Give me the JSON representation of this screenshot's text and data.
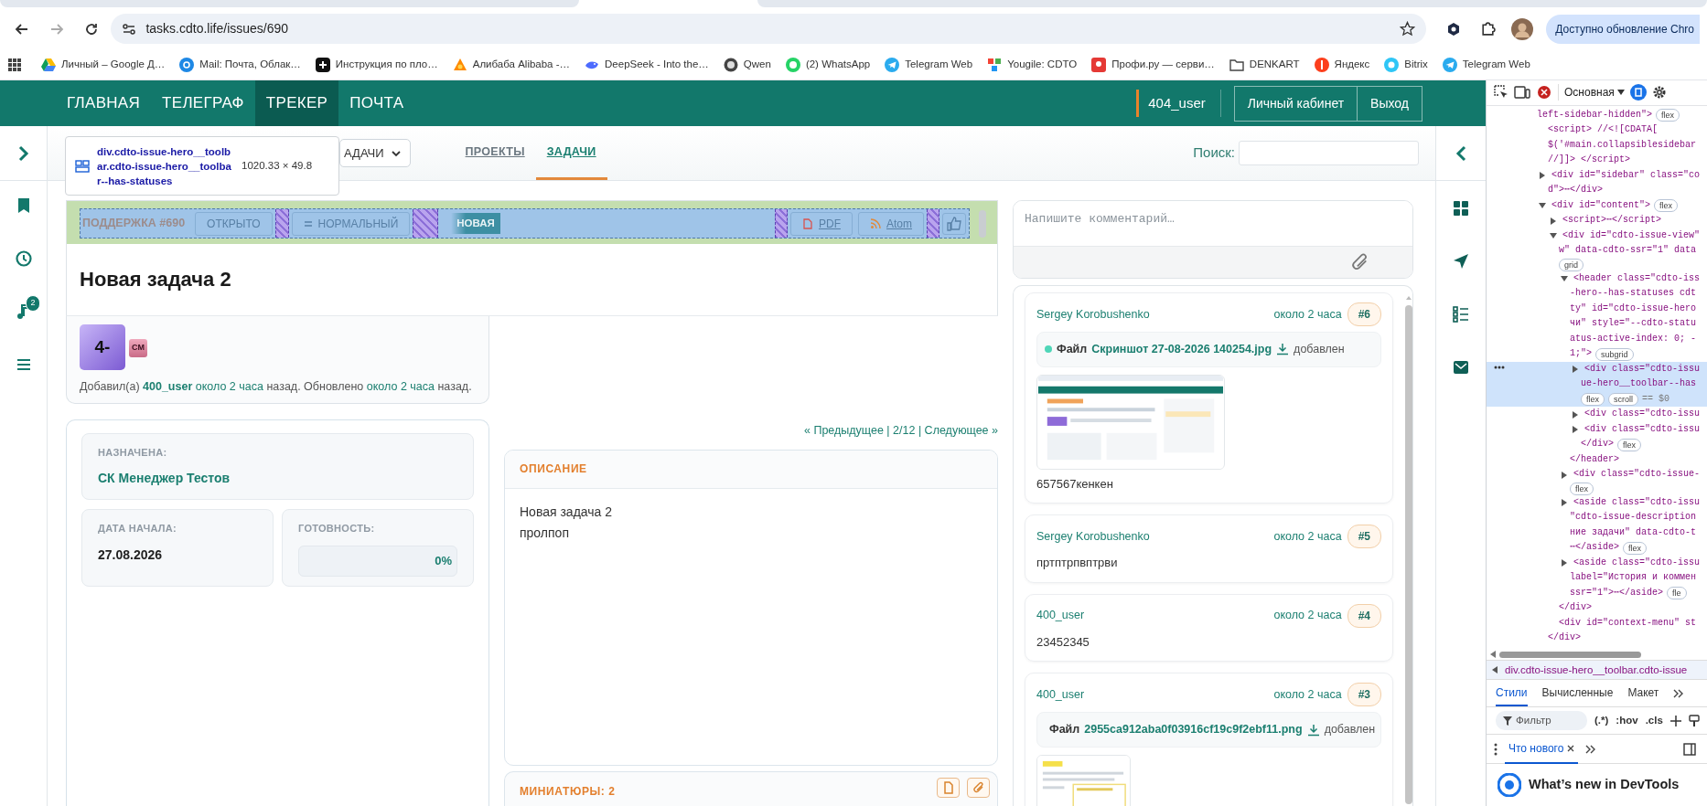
{
  "browser": {
    "address": "tasks.cdto.life/issues/690",
    "update_button": "Доступно обновление Chro",
    "bookmarks": [
      {
        "label": "Личный – Google Д…",
        "kind": "drive"
      },
      {
        "label": "Mail: Почта, Облак…",
        "kind": "mail"
      },
      {
        "label": "Инструкция по пло…",
        "kind": "plus"
      },
      {
        "label": "Алибаба Alibaba -…",
        "kind": "alibaba"
      },
      {
        "label": "DeepSeek - Into the…",
        "kind": "whale"
      },
      {
        "label": "Qwen",
        "kind": "qwen"
      },
      {
        "label": "(2) WhatsApp",
        "kind": "whatsapp"
      },
      {
        "label": "Telegram Web",
        "kind": "telegram"
      },
      {
        "label": "Yougile: CDTO",
        "kind": "yougile"
      },
      {
        "label": "Профи.ру — серви…",
        "kind": "profi"
      },
      {
        "label": "DENKART",
        "kind": "folder"
      },
      {
        "label": "Яндекс",
        "kind": "yandex"
      },
      {
        "label": "Bitrix",
        "kind": "bitrix"
      },
      {
        "label": "Telegram Web",
        "kind": "telegram"
      }
    ]
  },
  "navbar": {
    "items": [
      {
        "label": "ГЛАВНАЯ",
        "selected": false
      },
      {
        "label": "ТЕЛЕГРАФ",
        "selected": false
      },
      {
        "label": "ТРЕКЕР",
        "selected": true
      },
      {
        "label": "ПОЧТА",
        "selected": false
      }
    ],
    "user": "404_user",
    "buttons": [
      "Личный кабинет",
      "Выход"
    ]
  },
  "sidebar": {
    "badge": "2"
  },
  "subnav": {
    "dropdown": "АДАЧИ",
    "tabs": [
      {
        "label": "ПРОЕКТЫ",
        "selected": false
      },
      {
        "label": "ЗАДАЧИ",
        "selected": true
      }
    ],
    "search_label": "Поиск:"
  },
  "inspect_tooltip": {
    "selector": "div.cdto-issue-hero__toolbar.cdto-issue-hero__toolbar--has-statuses",
    "size": "1020.33 × 49.8"
  },
  "issue": {
    "tracker": "ПОДДЕРЖКА #690",
    "status": "ОТКРЫТО",
    "priority": "НОРМАЛЬНЫЙ",
    "state": "НОВАЯ",
    "exports": [
      {
        "label": "PDF",
        "kind": "pdf"
      },
      {
        "label": "Atom",
        "kind": "feed"
      }
    ],
    "title": "Новая задача 2",
    "avatar": "4-",
    "tag": "СМ",
    "byline": [
      {
        "kind": "text",
        "text": "Добавил(а)"
      },
      {
        "kind": "user",
        "text": "400_user"
      },
      {
        "kind": "link",
        "text": "около 2 часа"
      },
      {
        "kind": "text",
        "text": "назад. Обновлено"
      },
      {
        "kind": "link",
        "text": "около 2 часа"
      },
      {
        "kind": "text",
        "text": "назад."
      }
    ]
  },
  "fields": {
    "assigned": {
      "label": "НАЗНАЧЕНА:",
      "value": "СК Менеджер Тестов"
    },
    "start": {
      "label": "ДАТА НАЧАЛА:",
      "value": "27.08.2026"
    },
    "progress": {
      "label": "ГОТОВНОСТЬ:",
      "level": 0,
      "reading": "0%"
    }
  },
  "pager": {
    "prev": "« Предыдущее",
    "separator": "|",
    "position": "2/12",
    "next": "Следующее »"
  },
  "description": {
    "heading": "ОПИСАНИЕ",
    "lines": [
      "Новая задача 2",
      "пролпоп"
    ]
  },
  "thumbnails": {
    "heading": "МИНИАТЮРЫ: 2"
  },
  "comments": {
    "placeholder": "Напишите комментарий…",
    "items": [
      {
        "author": "Sergey Korobushenko",
        "time": "около 2 часа",
        "number": "#6",
        "file": {
          "label": "Файл",
          "name": "Скриншот 27-08-2026 140254.jpg",
          "suffix": "добавлен"
        },
        "text": "657567кенкен"
      },
      {
        "author": "Sergey Korobushenko",
        "time": "около 2 часа",
        "number": "#5",
        "text": "пртптрпвптрви"
      },
      {
        "author": "400_user",
        "time": "около 2 часа",
        "number": "#4",
        "text": "23452345"
      },
      {
        "author": "400_user",
        "time": "около 2 часа",
        "number": "#3",
        "file": {
          "label": "Файл",
          "name": "2955ca912aba0f03916cf19c9f2ebf11.png",
          "suffix": "добавлен"
        }
      }
    ]
  },
  "devtools": {
    "context": "Основная",
    "dom": [
      {
        "lines": [
          "left-sidebar-hidden\">"
        ],
        "badges": [
          "flex"
        ],
        "children": [
          {
            "lines": [
              "<script> //<![CDATA[",
              "$('#main.collapsiblesidebar",
              "//]]> </script>"
            ]
          },
          {
            "expanded": false,
            "lines": [
              "<div id=\"sidebar\" class=\"co",
              "d\">⋯</div>"
            ]
          },
          {
            "expanded": true,
            "lines": [
              "<div id=\"content\">"
            ],
            "badges": [
              "flex"
            ],
            "closing": "</div>",
            "children": [
              {
                "expanded": false,
                "lines": [
                  "<script>⋯</script>"
                ]
              },
              {
                "expanded": true,
                "lines": [
                  "<div id=\"cdto-issue-view\"",
                  "w\" data-cdto-ssr=\"1\" data"
                ],
                "badges": [
                  "grid"
                ],
                "closing": "</div>",
                "children": [
                  {
                    "expanded": true,
                    "lines": [
                      "<header class=\"cdto-iss",
                      "-hero--has-statuses cdt",
                      "ty\" id=\"cdto-issue-hero",
                      "чи\" style=\"--cdto-statu",
                      "atus-active-index: 0; -",
                      "1;\">"
                    ],
                    "badges": [
                      "subgrid"
                    ],
                    "closing": "</header>",
                    "children": [
                      {
                        "expanded": false,
                        "selected": true,
                        "lines": [
                          "<div class=\"cdto-issu",
                          "ue-hero__toolbar--has"
                        ],
                        "badges": [
                          "flex",
                          "scroll"
                        ],
                        "marker": "== $0"
                      },
                      {
                        "expanded": false,
                        "selected": false,
                        "lines": [
                          "<div class=\"cdto-issu"
                        ]
                      },
                      {
                        "expanded": false,
                        "selected": false,
                        "lines": [
                          "<div class=\"cdto-issu",
                          "</div>"
                        ],
                        "badges": [
                          "flex"
                        ]
                      }
                    ]
                  },
                  {
                    "expanded": false,
                    "lines": [
                      "<div class=\"cdto-issue-"
                    ],
                    "badges": [
                      "flex"
                    ]
                  },
                  {
                    "expanded": false,
                    "lines": [
                      "<aside class=\"cdto-issu",
                      "\"cdto-issue-description",
                      "ние задачи\" data-cdto-t",
                      "⋯</aside>"
                    ],
                    "badges": [
                      "flex"
                    ]
                  },
                  {
                    "expanded": false,
                    "lines": [
                      "<aside class=\"cdto-issu",
                      "label=\"История и коммен",
                      "ssr=\"1\">⋯</aside>"
                    ],
                    "badges": [
                      "fle"
                    ]
                  }
                ]
              },
              {
                "lines": [
                  "<div id=\"context-menu\" st"
                ]
              }
            ]
          }
        ]
      }
    ],
    "breadcrumb": "div.cdto-issue-hero__toolbar.cdto-issue",
    "tabs": [
      {
        "label": "Стили",
        "selected": true
      },
      {
        "label": "Вычисленные",
        "selected": false
      },
      {
        "label": "Макет",
        "selected": false
      }
    ],
    "filter_placeholder": "Фильтр",
    "filter_buttons": [
      "(.*)",
      ":hov",
      ".cls"
    ],
    "drawer_tab": "Что нового",
    "whats_new": "What’s new in DevTools"
  }
}
